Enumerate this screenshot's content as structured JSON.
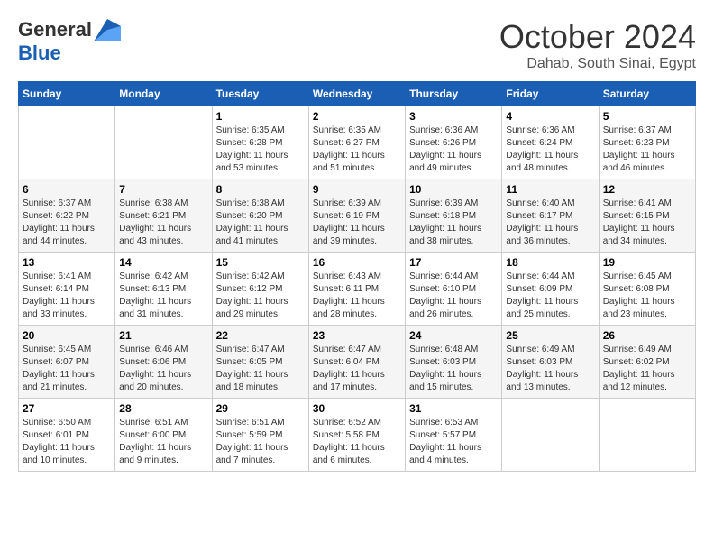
{
  "logo": {
    "general": "General",
    "blue": "Blue"
  },
  "title": "October 2024",
  "location": "Dahab, South Sinai, Egypt",
  "days_header": [
    "Sunday",
    "Monday",
    "Tuesday",
    "Wednesday",
    "Thursday",
    "Friday",
    "Saturday"
  ],
  "weeks": [
    [
      {
        "day": "",
        "sunrise": "",
        "sunset": "",
        "daylight": ""
      },
      {
        "day": "",
        "sunrise": "",
        "sunset": "",
        "daylight": ""
      },
      {
        "day": "1",
        "sunrise": "Sunrise: 6:35 AM",
        "sunset": "Sunset: 6:28 PM",
        "daylight": "Daylight: 11 hours and 53 minutes."
      },
      {
        "day": "2",
        "sunrise": "Sunrise: 6:35 AM",
        "sunset": "Sunset: 6:27 PM",
        "daylight": "Daylight: 11 hours and 51 minutes."
      },
      {
        "day": "3",
        "sunrise": "Sunrise: 6:36 AM",
        "sunset": "Sunset: 6:26 PM",
        "daylight": "Daylight: 11 hours and 49 minutes."
      },
      {
        "day": "4",
        "sunrise": "Sunrise: 6:36 AM",
        "sunset": "Sunset: 6:24 PM",
        "daylight": "Daylight: 11 hours and 48 minutes."
      },
      {
        "day": "5",
        "sunrise": "Sunrise: 6:37 AM",
        "sunset": "Sunset: 6:23 PM",
        "daylight": "Daylight: 11 hours and 46 minutes."
      }
    ],
    [
      {
        "day": "6",
        "sunrise": "Sunrise: 6:37 AM",
        "sunset": "Sunset: 6:22 PM",
        "daylight": "Daylight: 11 hours and 44 minutes."
      },
      {
        "day": "7",
        "sunrise": "Sunrise: 6:38 AM",
        "sunset": "Sunset: 6:21 PM",
        "daylight": "Daylight: 11 hours and 43 minutes."
      },
      {
        "day": "8",
        "sunrise": "Sunrise: 6:38 AM",
        "sunset": "Sunset: 6:20 PM",
        "daylight": "Daylight: 11 hours and 41 minutes."
      },
      {
        "day": "9",
        "sunrise": "Sunrise: 6:39 AM",
        "sunset": "Sunset: 6:19 PM",
        "daylight": "Daylight: 11 hours and 39 minutes."
      },
      {
        "day": "10",
        "sunrise": "Sunrise: 6:39 AM",
        "sunset": "Sunset: 6:18 PM",
        "daylight": "Daylight: 11 hours and 38 minutes."
      },
      {
        "day": "11",
        "sunrise": "Sunrise: 6:40 AM",
        "sunset": "Sunset: 6:17 PM",
        "daylight": "Daylight: 11 hours and 36 minutes."
      },
      {
        "day": "12",
        "sunrise": "Sunrise: 6:41 AM",
        "sunset": "Sunset: 6:15 PM",
        "daylight": "Daylight: 11 hours and 34 minutes."
      }
    ],
    [
      {
        "day": "13",
        "sunrise": "Sunrise: 6:41 AM",
        "sunset": "Sunset: 6:14 PM",
        "daylight": "Daylight: 11 hours and 33 minutes."
      },
      {
        "day": "14",
        "sunrise": "Sunrise: 6:42 AM",
        "sunset": "Sunset: 6:13 PM",
        "daylight": "Daylight: 11 hours and 31 minutes."
      },
      {
        "day": "15",
        "sunrise": "Sunrise: 6:42 AM",
        "sunset": "Sunset: 6:12 PM",
        "daylight": "Daylight: 11 hours and 29 minutes."
      },
      {
        "day": "16",
        "sunrise": "Sunrise: 6:43 AM",
        "sunset": "Sunset: 6:11 PM",
        "daylight": "Daylight: 11 hours and 28 minutes."
      },
      {
        "day": "17",
        "sunrise": "Sunrise: 6:44 AM",
        "sunset": "Sunset: 6:10 PM",
        "daylight": "Daylight: 11 hours and 26 minutes."
      },
      {
        "day": "18",
        "sunrise": "Sunrise: 6:44 AM",
        "sunset": "Sunset: 6:09 PM",
        "daylight": "Daylight: 11 hours and 25 minutes."
      },
      {
        "day": "19",
        "sunrise": "Sunrise: 6:45 AM",
        "sunset": "Sunset: 6:08 PM",
        "daylight": "Daylight: 11 hours and 23 minutes."
      }
    ],
    [
      {
        "day": "20",
        "sunrise": "Sunrise: 6:45 AM",
        "sunset": "Sunset: 6:07 PM",
        "daylight": "Daylight: 11 hours and 21 minutes."
      },
      {
        "day": "21",
        "sunrise": "Sunrise: 6:46 AM",
        "sunset": "Sunset: 6:06 PM",
        "daylight": "Daylight: 11 hours and 20 minutes."
      },
      {
        "day": "22",
        "sunrise": "Sunrise: 6:47 AM",
        "sunset": "Sunset: 6:05 PM",
        "daylight": "Daylight: 11 hours and 18 minutes."
      },
      {
        "day": "23",
        "sunrise": "Sunrise: 6:47 AM",
        "sunset": "Sunset: 6:04 PM",
        "daylight": "Daylight: 11 hours and 17 minutes."
      },
      {
        "day": "24",
        "sunrise": "Sunrise: 6:48 AM",
        "sunset": "Sunset: 6:03 PM",
        "daylight": "Daylight: 11 hours and 15 minutes."
      },
      {
        "day": "25",
        "sunrise": "Sunrise: 6:49 AM",
        "sunset": "Sunset: 6:03 PM",
        "daylight": "Daylight: 11 hours and 13 minutes."
      },
      {
        "day": "26",
        "sunrise": "Sunrise: 6:49 AM",
        "sunset": "Sunset: 6:02 PM",
        "daylight": "Daylight: 11 hours and 12 minutes."
      }
    ],
    [
      {
        "day": "27",
        "sunrise": "Sunrise: 6:50 AM",
        "sunset": "Sunset: 6:01 PM",
        "daylight": "Daylight: 11 hours and 10 minutes."
      },
      {
        "day": "28",
        "sunrise": "Sunrise: 6:51 AM",
        "sunset": "Sunset: 6:00 PM",
        "daylight": "Daylight: 11 hours and 9 minutes."
      },
      {
        "day": "29",
        "sunrise": "Sunrise: 6:51 AM",
        "sunset": "Sunset: 5:59 PM",
        "daylight": "Daylight: 11 hours and 7 minutes."
      },
      {
        "day": "30",
        "sunrise": "Sunrise: 6:52 AM",
        "sunset": "Sunset: 5:58 PM",
        "daylight": "Daylight: 11 hours and 6 minutes."
      },
      {
        "day": "31",
        "sunrise": "Sunrise: 6:53 AM",
        "sunset": "Sunset: 5:57 PM",
        "daylight": "Daylight: 11 hours and 4 minutes."
      },
      {
        "day": "",
        "sunrise": "",
        "sunset": "",
        "daylight": ""
      },
      {
        "day": "",
        "sunrise": "",
        "sunset": "",
        "daylight": ""
      }
    ]
  ]
}
